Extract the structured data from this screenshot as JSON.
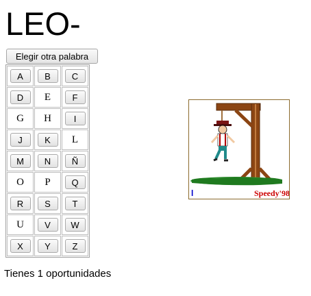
{
  "word": {
    "display": "LEO-"
  },
  "new_word_button": {
    "label": "Elegir otra palabra"
  },
  "letters": [
    [
      {
        "letter": "A",
        "available": true
      },
      {
        "letter": "B",
        "available": true
      },
      {
        "letter": "C",
        "available": true
      }
    ],
    [
      {
        "letter": "D",
        "available": true
      },
      {
        "letter": "E",
        "available": false
      },
      {
        "letter": "F",
        "available": true
      }
    ],
    [
      {
        "letter": "G",
        "available": false
      },
      {
        "letter": "H",
        "available": false
      },
      {
        "letter": "I",
        "available": true
      }
    ],
    [
      {
        "letter": "J",
        "available": true
      },
      {
        "letter": "K",
        "available": true
      },
      {
        "letter": "L",
        "available": false
      }
    ],
    [
      {
        "letter": "M",
        "available": true
      },
      {
        "letter": "N",
        "available": true
      },
      {
        "letter": "Ñ",
        "available": true
      }
    ],
    [
      {
        "letter": "O",
        "available": false
      },
      {
        "letter": "P",
        "available": false
      },
      {
        "letter": "Q",
        "available": true
      }
    ],
    [
      {
        "letter": "R",
        "available": true
      },
      {
        "letter": "S",
        "available": true
      },
      {
        "letter": "T",
        "available": true
      }
    ],
    [
      {
        "letter": "U",
        "available": false
      },
      {
        "letter": "V",
        "available": true
      },
      {
        "letter": "W",
        "available": true
      }
    ],
    [
      {
        "letter": "X",
        "available": true
      },
      {
        "letter": "Y",
        "available": true
      },
      {
        "letter": "Z",
        "available": true
      }
    ]
  ],
  "hangman_image": {
    "signature": "Speedy'98",
    "mark": "l"
  },
  "status": {
    "text": "Tienes 1 oportunidades"
  },
  "colors": {
    "wood": "#8b4513",
    "grass": "#2e8b2e",
    "signature": "#cc0000",
    "mark": "#0000cc"
  }
}
